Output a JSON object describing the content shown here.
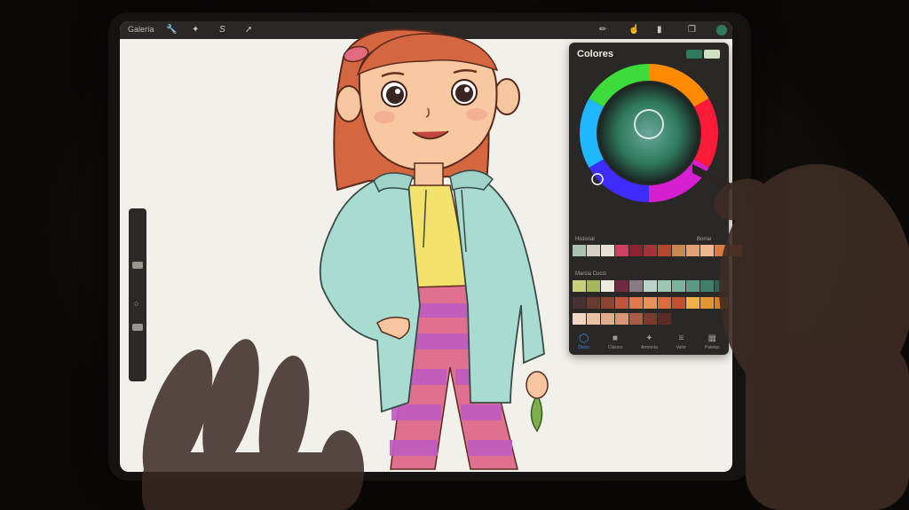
{
  "topbar": {
    "gallery_label": "Galería",
    "tools_left": [
      "wrench-icon",
      "magic-wand-icon",
      "selection-s-icon",
      "transform-arrow-icon"
    ],
    "tools_right": [
      "brush-icon",
      "smudge-icon",
      "eraser-icon",
      "layers-icon",
      "color-dot-icon"
    ]
  },
  "color_panel": {
    "title": "Colores",
    "current_colors": [
      "#2f7a5e",
      "#cfe1c3"
    ],
    "history_label": "Historial",
    "clear_label": "Borrar",
    "history_swatches": [
      "#a9c4b1",
      "#d4d0c4",
      "#e7e2d8",
      "#cf3f64",
      "#8a2231",
      "#a3353a",
      "#b3462d",
      "#c98750",
      "#e3a070",
      "#f0b78a",
      "#da7b45",
      "#c35b35"
    ],
    "palette_label": "Marcia Cucci",
    "palette_rows": [
      [
        "#c9cf7a",
        "#a5b75a",
        "#eeeae0",
        "#6e2b40",
        "#8a7a85",
        "#b8d5c8",
        "#9cc7b4",
        "#7bb39f",
        "#5d9b86",
        "#3f7f6c",
        "#2c6454"
      ],
      [
        "#4a3135",
        "#6b3a2e",
        "#8c4530",
        "#c0553c",
        "#e07a4d",
        "#e89158",
        "#d96d3d",
        "#c34f33",
        "#f0b14a",
        "#e5962f",
        "#d78028"
      ],
      [
        "#f1d7c4",
        "#e9c2a6",
        "#e2ad8d",
        "#d99574",
        "#ab5a45",
        "#7a3a30",
        "#5c2b28"
      ]
    ],
    "tabs": [
      {
        "label": "Disco",
        "icon": "disc-icon",
        "active": true
      },
      {
        "label": "Clásico",
        "icon": "square-icon",
        "active": false
      },
      {
        "label": "Armonía",
        "icon": "harmony-icon",
        "active": false
      },
      {
        "label": "Valor",
        "icon": "sliders-icon",
        "active": false
      },
      {
        "label": "Paletas",
        "icon": "grid-icon",
        "active": false
      }
    ]
  }
}
